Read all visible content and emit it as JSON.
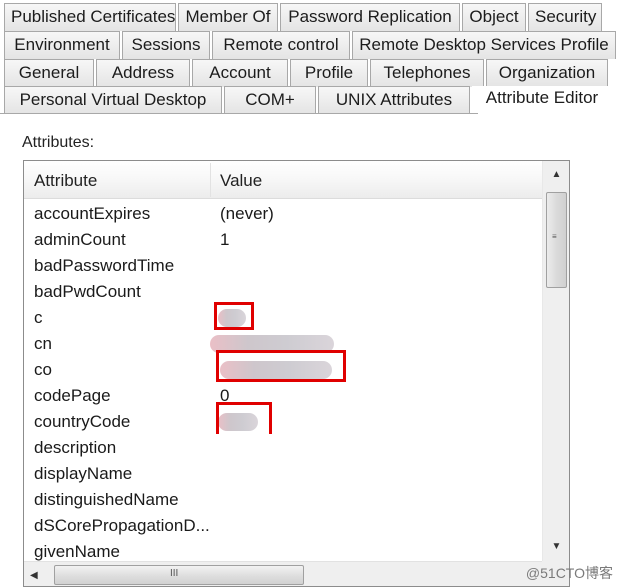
{
  "tabs": {
    "row1": [
      "Published Certificates",
      "Member Of",
      "Password Replication",
      "Object",
      "Security"
    ],
    "row2": [
      "Environment",
      "Sessions",
      "Remote control",
      "Remote Desktop Services Profile"
    ],
    "row3": [
      "General",
      "Address",
      "Account",
      "Profile",
      "Telephones",
      "Organization"
    ],
    "row4": [
      "Personal Virtual Desktop",
      "COM+",
      "UNIX Attributes",
      "Attribute Editor"
    ],
    "active": "Attribute Editor"
  },
  "attributes_label": "Attributes:",
  "list": {
    "columns": {
      "attribute": "Attribute",
      "value": "Value"
    },
    "rows": [
      {
        "attribute": "accountExpires",
        "value": "(never)"
      },
      {
        "attribute": "adminCount",
        "value": "1"
      },
      {
        "attribute": "badPasswordTime",
        "value": ""
      },
      {
        "attribute": "badPwdCount",
        "value": ""
      },
      {
        "attribute": "c",
        "value": "[redacted]"
      },
      {
        "attribute": "cn",
        "value": "[redacted]"
      },
      {
        "attribute": "co",
        "value": "[redacted]"
      },
      {
        "attribute": "codePage",
        "value": "0"
      },
      {
        "attribute": "countryCode",
        "value": "[redacted]"
      },
      {
        "attribute": "description",
        "value": ""
      },
      {
        "attribute": "displayName",
        "value": ""
      },
      {
        "attribute": "distinguishedName",
        "value": ""
      },
      {
        "attribute": "dSCorePropagationD...",
        "value": ""
      },
      {
        "attribute": "givenName",
        "value": ""
      }
    ]
  },
  "icons": {
    "scroll_up": "▲",
    "scroll_down": "▼",
    "scroll_left": "◀",
    "grip_v": "≡",
    "grip_h": "III"
  },
  "highlight_color": "#e00000",
  "watermark": "@51CTO博客"
}
